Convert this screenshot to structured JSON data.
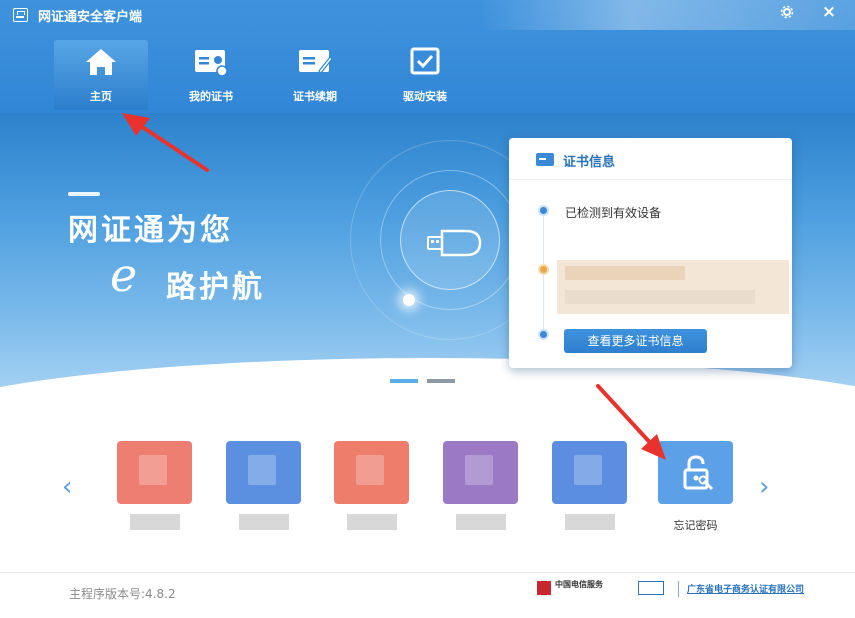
{
  "window": {
    "title": "网证通安全客户端",
    "settings_icon": "gear-icon",
    "close_label": "×"
  },
  "nav": {
    "tabs": [
      {
        "label": "主页",
        "icon": "home-icon",
        "active": true
      },
      {
        "label": "我的证书",
        "icon": "id-card-icon",
        "active": false
      },
      {
        "label": "证书续期",
        "icon": "cert-renew-icon",
        "active": false
      },
      {
        "label": "驱动安装",
        "icon": "checkbox-icon",
        "active": false
      }
    ]
  },
  "banner": {
    "slogan_line1": "网证通为您",
    "slogan_e": "e",
    "slogan_line2": "路护航"
  },
  "cert_info": {
    "title": "证书信息",
    "status": "已检测到有效设备",
    "more_button": "查看更多证书信息"
  },
  "functions": {
    "prev": "‹",
    "next": "›",
    "forgot_password": "忘记密码"
  },
  "footer": {
    "version": "主程序版本号:4.8.2",
    "telecom": "中国电信服务",
    "company": "广东省电子商务认证有限公司"
  },
  "colors": {
    "header_blue": "#3186d6",
    "accent_blue": "#3a8ad8",
    "annotation_red": "#e8322b"
  }
}
